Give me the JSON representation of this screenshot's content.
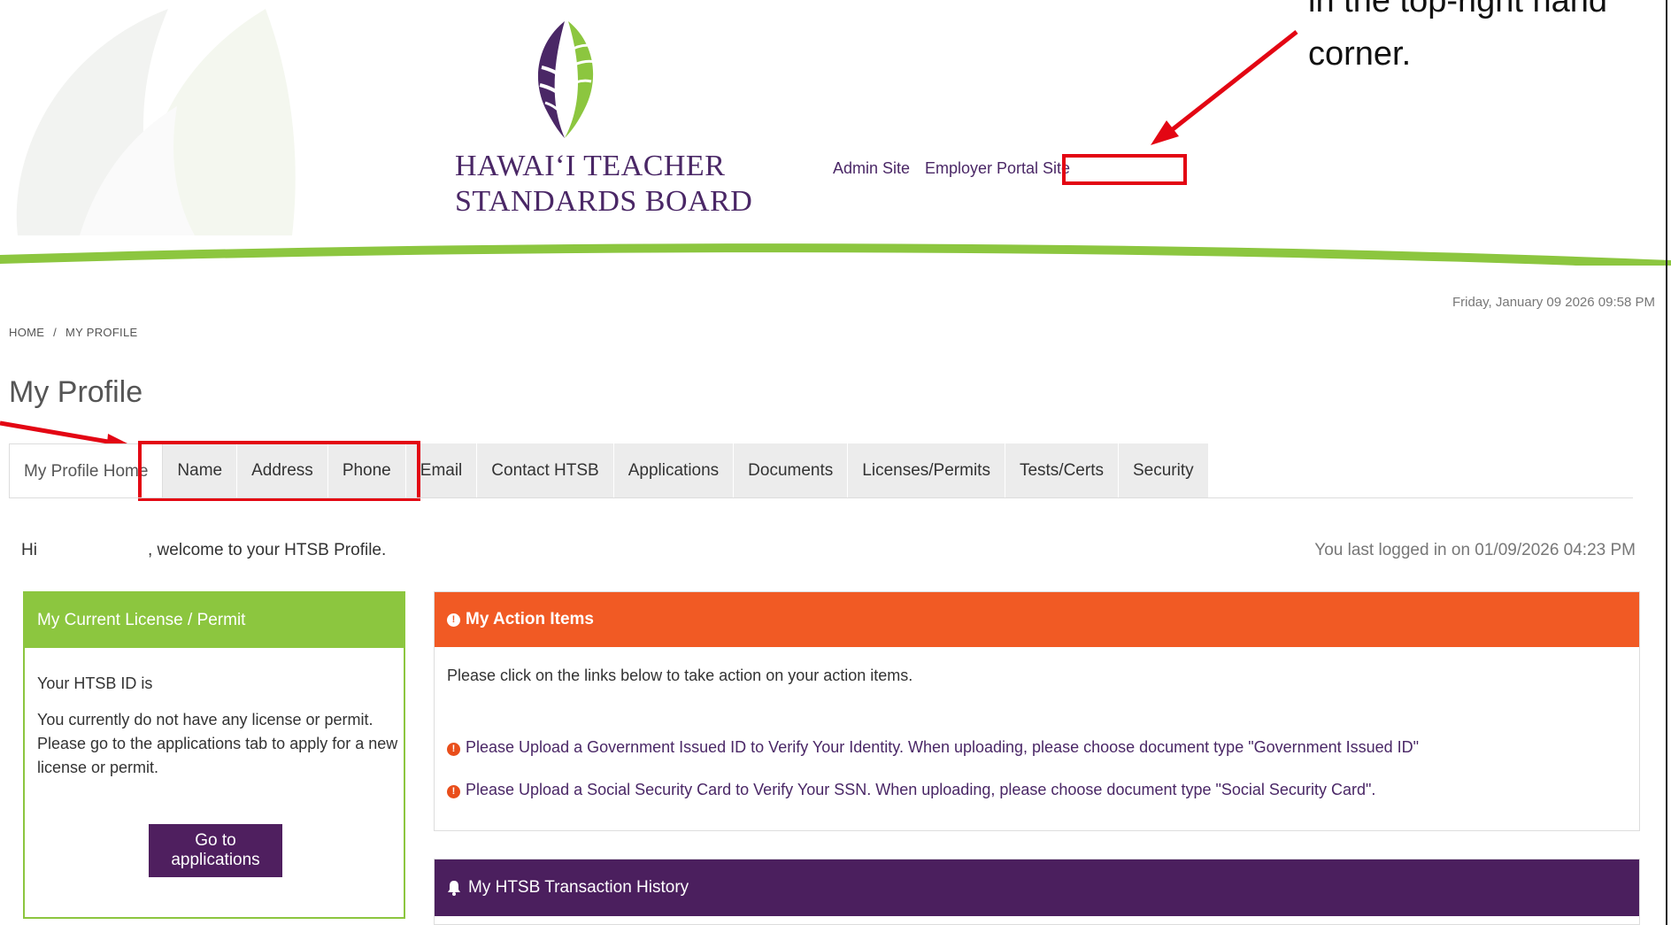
{
  "header": {
    "logo_line1": "HAWAIʻI TEACHER",
    "logo_line2": "STANDARDS BOARD",
    "links": {
      "admin": "Admin Site",
      "employer": "Employer Portal Site"
    }
  },
  "annotation": {
    "line1": "in the top-right hand",
    "line2": "corner."
  },
  "datetime": "Friday, January 09 2026 09:58 PM",
  "breadcrumb": {
    "home": "HOME",
    "separator": "/",
    "current": "MY PROFILE"
  },
  "page_title": "My Profile",
  "tabs": [
    {
      "label": "My Profile Home"
    },
    {
      "label": "Name"
    },
    {
      "label": "Address"
    },
    {
      "label": "Phone"
    },
    {
      "label": "Email"
    },
    {
      "label": "Contact HTSB"
    },
    {
      "label": "Applications"
    },
    {
      "label": "Documents"
    },
    {
      "label": "Licenses/Permits"
    },
    {
      "label": "Tests/Certs"
    },
    {
      "label": "Security"
    }
  ],
  "greeting": {
    "prefix": "Hi",
    "suffix": ", welcome to your HTSB Profile."
  },
  "last_login": "You last logged in on 01/09/2026 04:23 PM",
  "license_panel": {
    "title": "My Current License / Permit",
    "id_text": "Your HTSB ID is",
    "message": "You currently do not have any license or permit. Please go to the applications tab to apply for a new license or permit.",
    "button": "Go to applications"
  },
  "action_panel": {
    "title": "My Action Items",
    "intro": "Please click on the links below to take action on your action items.",
    "items": [
      "Please Upload a Government Issued ID to Verify Your Identity. When uploading, please choose document type \"Government Issued ID\"",
      "Please Upload a Social Security Card to Verify Your SSN. When uploading, please choose document type \"Social Security Card\"."
    ]
  },
  "history_panel": {
    "title": "My HTSB Transaction History"
  },
  "colors": {
    "brand_purple": "#4a2766",
    "brand_green": "#8cc63f",
    "alert_orange": "#f15a24",
    "annotation_red": "#e30613"
  }
}
